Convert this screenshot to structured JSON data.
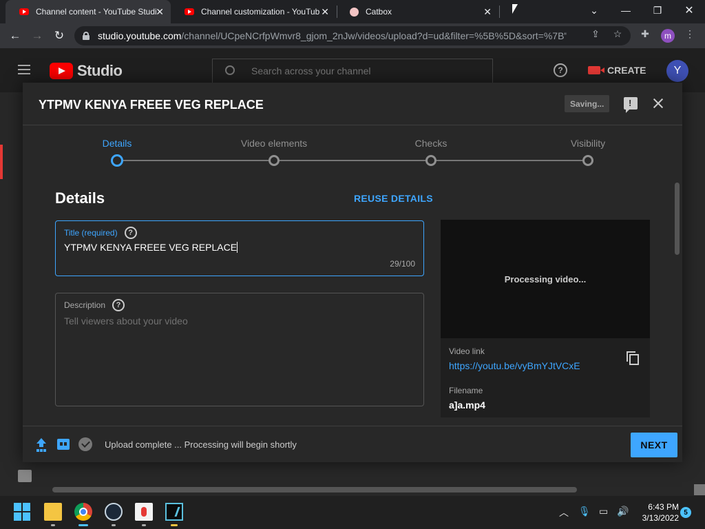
{
  "browser": {
    "tabs": [
      {
        "label": "Channel content - YouTube Studio",
        "active": true
      },
      {
        "label": "Channel customization - YouTube Studio",
        "active": false
      },
      {
        "label": "Catbox",
        "active": false
      }
    ],
    "url_host": "studio.youtube.com",
    "url_path": "/channel/UCpeNCrfpWmvr8_gjom_2nJw/videos/upload?d=ud&filter=%5B%5D&sort=%7B\"c...",
    "profile_initial": "m"
  },
  "studio": {
    "logo_text": "Studio",
    "search_placeholder": "Search across your channel",
    "create_label": "CREATE",
    "avatar_initial": "Y"
  },
  "modal": {
    "title": "YTPMV KENYA FREEE VEG REPLACE",
    "saving_label": "Saving...",
    "steps": [
      {
        "label": "Details",
        "active": true
      },
      {
        "label": "Video elements",
        "active": false
      },
      {
        "label": "Checks",
        "active": false
      },
      {
        "label": "Visibility",
        "active": false
      }
    ],
    "section_heading": "Details",
    "reuse_label": "REUSE DETAILS",
    "title_field": {
      "label": "Title (required)",
      "value": "YTPMV KENYA FREEE VEG REPLACE",
      "counter": "29/100"
    },
    "description_field": {
      "label": "Description",
      "placeholder": "Tell viewers about your video"
    },
    "preview": {
      "status": "Processing video...",
      "video_link_label": "Video link",
      "video_link": "https://youtu.be/vyBmYJtVCxE",
      "filename_label": "Filename",
      "filename": "a]a.mp4"
    },
    "footer": {
      "status": "Upload complete ... Processing will begin shortly",
      "next_label": "NEXT"
    }
  },
  "taskbar": {
    "time": "6:43 PM",
    "date": "3/13/2022",
    "notification_count": "5"
  },
  "colors": {
    "accent": "#3ea6ff",
    "youtube_red": "#ff0000",
    "modal_bg": "#282828"
  }
}
